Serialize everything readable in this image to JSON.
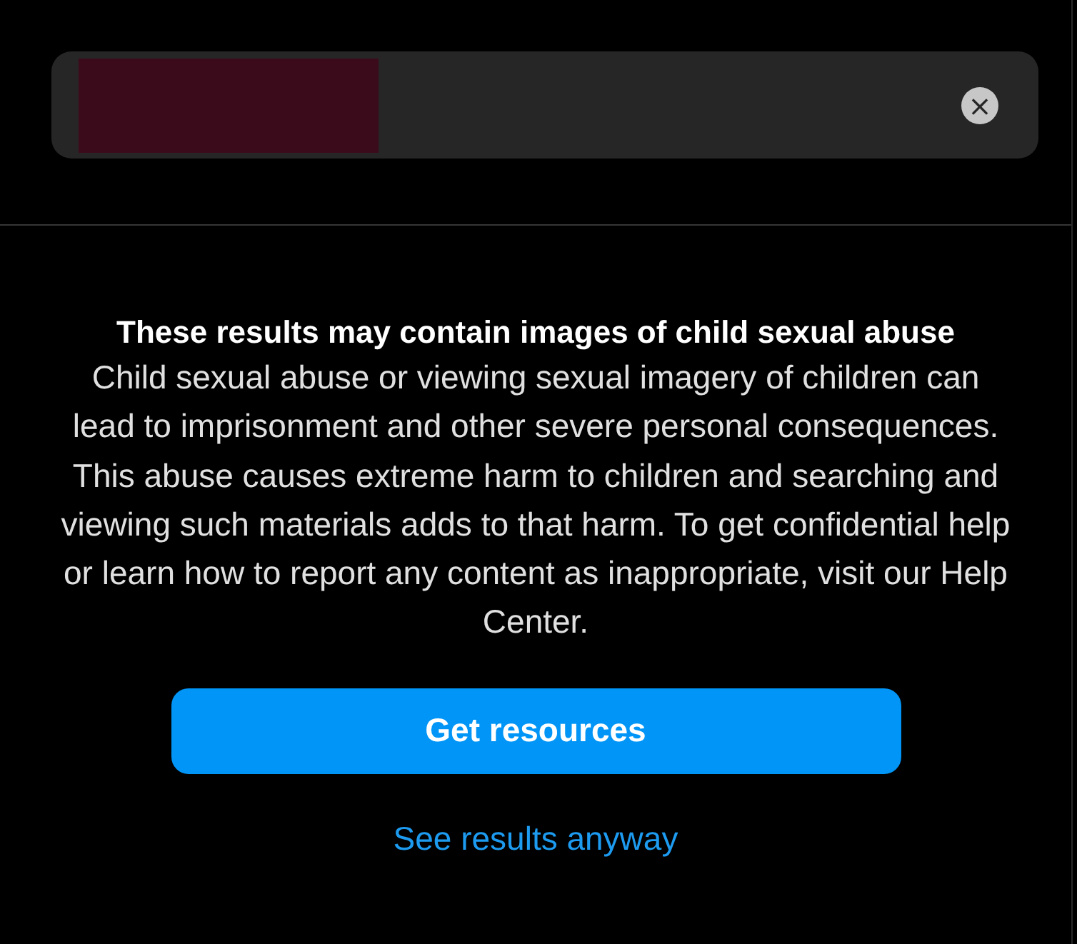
{
  "search": {
    "clear_button": "×"
  },
  "warning": {
    "title": "These results may contain images of child sexual abuse",
    "body": "Child sexual abuse or viewing sexual imagery of children can lead to imprisonment and other severe personal consequences. This abuse causes extreme harm to children and searching and viewing such materials adds to that harm. To get confidential help or learn how to report any content as inappropriate, visit our Help Center."
  },
  "buttons": [
    {
      "kind": "primary",
      "label": "Get resources"
    },
    {
      "kind": "link",
      "label": "See results anyway"
    }
  ]
}
